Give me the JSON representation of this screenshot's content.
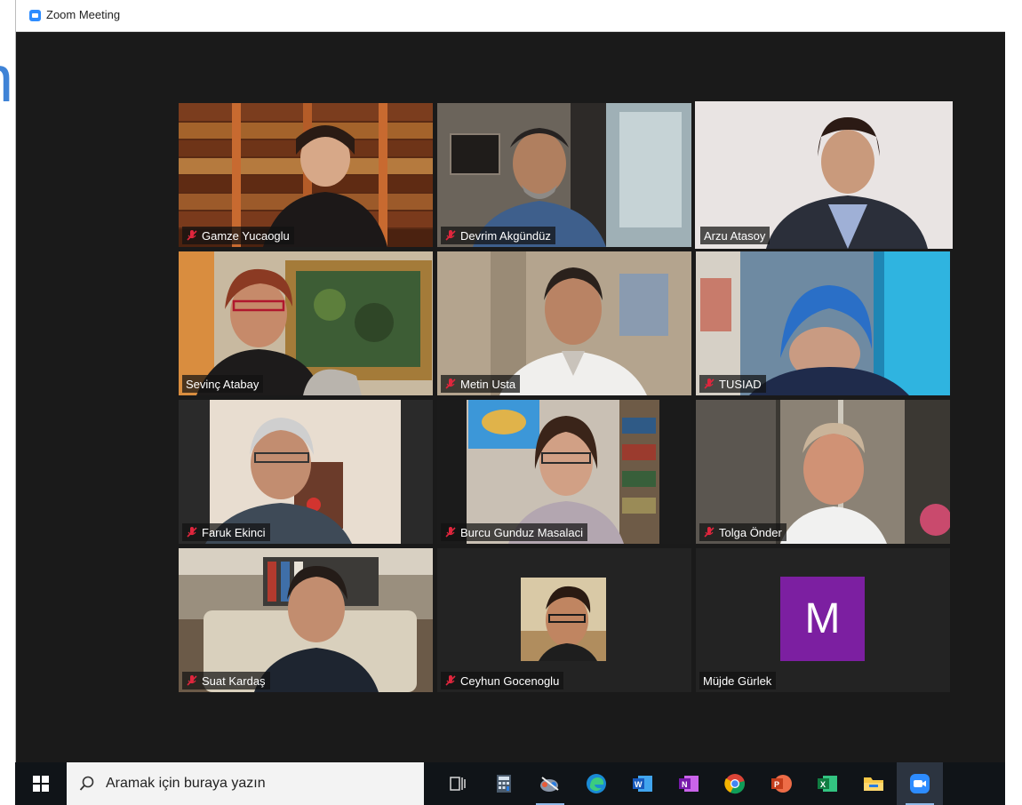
{
  "window": {
    "title": "Zoom Meeting"
  },
  "participants": [
    {
      "name": "Gamze Yucaoglu",
      "muted": true,
      "scene": "bookshelf",
      "active": false
    },
    {
      "name": "Devrim Akgündüz",
      "muted": true,
      "scene": "office-window",
      "active": false
    },
    {
      "name": "Arzu Atasoy",
      "muted": false,
      "scene": "plain-light",
      "active": true
    },
    {
      "name": "Sevinç Atabay",
      "muted": false,
      "scene": "painting",
      "active": false
    },
    {
      "name": "Metin Usta",
      "muted": true,
      "scene": "office-wall",
      "active": false
    },
    {
      "name": "TUSIAD",
      "muted": true,
      "scene": "blue-room",
      "active": false
    },
    {
      "name": "Faruk Ekinci",
      "muted": true,
      "scene": "home-interior",
      "active": false
    },
    {
      "name": "Burcu Gunduz Masalaci",
      "muted": true,
      "scene": "bookshelf-map",
      "active": false
    },
    {
      "name": "Tolga Önder",
      "muted": true,
      "scene": "glass-office",
      "active": false
    },
    {
      "name": "Suat Kardaş",
      "muted": true,
      "scene": "living-room",
      "active": false
    },
    {
      "name": "Ceyhun Gocenoglu",
      "muted": true,
      "scene": "profile-photo",
      "active": false
    },
    {
      "name": "Müjde Gürlek",
      "muted": false,
      "scene": "avatar",
      "avatar_letter": "M",
      "active": false
    }
  ],
  "taskbar": {
    "search_placeholder": "Aramak için buraya yazın",
    "apps": [
      {
        "name": "task-view"
      },
      {
        "name": "calculator"
      },
      {
        "name": "snipping-tool"
      },
      {
        "name": "edge"
      },
      {
        "name": "word"
      },
      {
        "name": "onenote"
      },
      {
        "name": "chrome"
      },
      {
        "name": "powerpoint"
      },
      {
        "name": "excel"
      },
      {
        "name": "file-explorer"
      },
      {
        "name": "zoom"
      }
    ]
  },
  "colors": {
    "active_speaker_border": "#e6f28c",
    "meeting_background": "#1a1a1a",
    "muted_icon": "#e0263d",
    "avatar_bg": "#7c1fa1"
  }
}
